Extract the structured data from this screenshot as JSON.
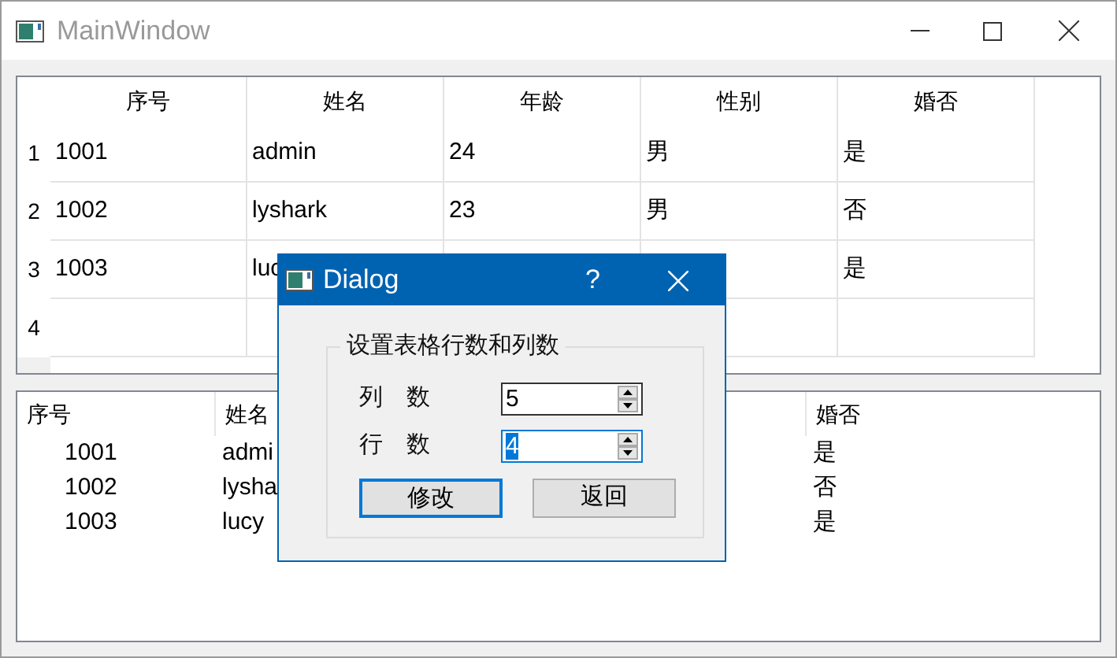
{
  "window": {
    "title": "MainWindow"
  },
  "table": {
    "columns": [
      "序号",
      "姓名",
      "年龄",
      "性别",
      "婚否"
    ],
    "rows": [
      {
        "header": "1",
        "cells": [
          "1001",
          "admin",
          "24",
          "男",
          "是"
        ]
      },
      {
        "header": "2",
        "cells": [
          "1002",
          "lyshark",
          "23",
          "男",
          "否"
        ]
      },
      {
        "header": "3",
        "cells": [
          "1003",
          "luc",
          null,
          null,
          "是"
        ]
      },
      {
        "header": "4"
      }
    ]
  },
  "tree": {
    "columns": [
      "序号",
      "姓名",
      null,
      null,
      "婚否"
    ],
    "rows": [
      [
        "1001",
        "admi",
        null,
        null,
        "是"
      ],
      [
        "1002",
        "lysha",
        null,
        null,
        "否"
      ],
      [
        "1003",
        "lucy",
        null,
        null,
        "是"
      ]
    ]
  },
  "dialog": {
    "title": "Dialog",
    "help": "?",
    "group_title": "设置表格行数和列数",
    "fields": [
      {
        "label": "列　数",
        "value": "5",
        "focused": false
      },
      {
        "label": "行　数",
        "value": "4",
        "focused": true
      }
    ],
    "buttons": [
      {
        "label": "修改",
        "default": true
      },
      {
        "label": "返回",
        "default": false
      }
    ]
  }
}
